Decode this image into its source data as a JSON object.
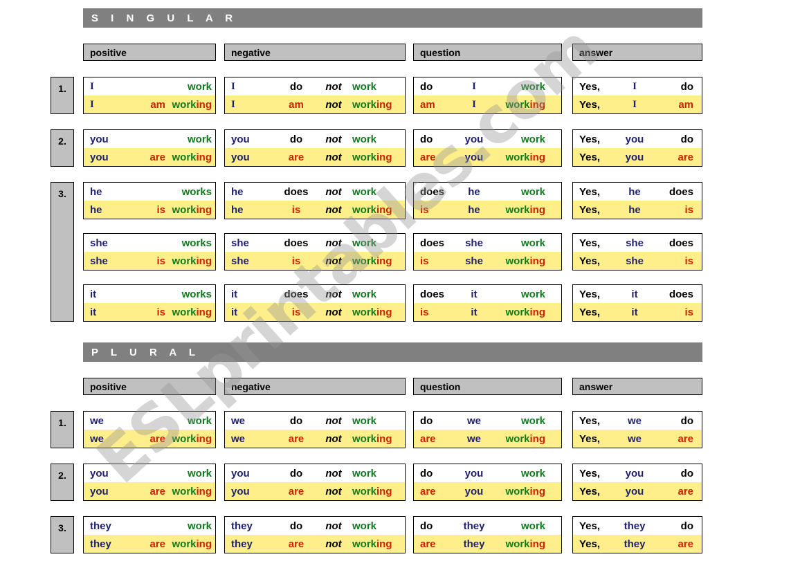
{
  "sections": [
    {
      "title": "S I N G U L A R",
      "headers": [
        "positive",
        "negative",
        "question",
        "answer"
      ],
      "groups": [
        {
          "number": "1.",
          "rows": [
            {
              "positive": {
                "simple": [
                  "I",
                  "",
                  "work"
                ],
                "cont": [
                  "I",
                  "am",
                  "work",
                  "ing"
                ]
              },
              "negative": {
                "simple": [
                  "I",
                  "do",
                  "not",
                  "work"
                ],
                "cont": [
                  "I",
                  "am",
                  "not",
                  "work",
                  "ing"
                ]
              },
              "question": {
                "simple": [
                  "do",
                  "I",
                  "work"
                ],
                "cont": [
                  "am",
                  "I",
                  "work",
                  "ing"
                ]
              },
              "answer": {
                "simple": [
                  "Yes,",
                  "I",
                  "do"
                ],
                "cont": [
                  "Yes,",
                  "I",
                  "am"
                ]
              }
            }
          ]
        },
        {
          "number": "2.",
          "rows": [
            {
              "positive": {
                "simple": [
                  "you",
                  "",
                  "work"
                ],
                "cont": [
                  "you",
                  "are",
                  "work",
                  "ing"
                ]
              },
              "negative": {
                "simple": [
                  "you",
                  "do",
                  "not",
                  "work"
                ],
                "cont": [
                  "you",
                  "are",
                  "not",
                  "work",
                  "ing"
                ]
              },
              "question": {
                "simple": [
                  "do",
                  "you",
                  "work"
                ],
                "cont": [
                  "are",
                  "you",
                  "work",
                  "ing"
                ]
              },
              "answer": {
                "simple": [
                  "Yes,",
                  "you",
                  "do"
                ],
                "cont": [
                  "Yes,",
                  "you",
                  "are"
                ]
              }
            }
          ]
        },
        {
          "number": "3.",
          "rows": [
            {
              "positive": {
                "simple": [
                  "he",
                  "",
                  "works"
                ],
                "cont": [
                  "he",
                  "is",
                  "work",
                  "ing"
                ]
              },
              "negative": {
                "simple": [
                  "he",
                  "does",
                  "not",
                  "work"
                ],
                "cont": [
                  "he",
                  "is",
                  "not",
                  "work",
                  "ing"
                ]
              },
              "question": {
                "simple": [
                  "does",
                  "he",
                  "work"
                ],
                "cont": [
                  "is",
                  "he",
                  "work",
                  "ing"
                ]
              },
              "answer": {
                "simple": [
                  "Yes,",
                  "he",
                  "does"
                ],
                "cont": [
                  "Yes,",
                  "he",
                  "is"
                ]
              }
            },
            {
              "positive": {
                "simple": [
                  "she",
                  "",
                  "works"
                ],
                "cont": [
                  "she",
                  "is",
                  "work",
                  "ing"
                ]
              },
              "negative": {
                "simple": [
                  "she",
                  "does",
                  "not",
                  "work"
                ],
                "cont": [
                  "she",
                  "is",
                  "not",
                  "work",
                  "ing"
                ]
              },
              "question": {
                "simple": [
                  "does",
                  "she",
                  "work"
                ],
                "cont": [
                  "is",
                  "she",
                  "work",
                  "ing"
                ]
              },
              "answer": {
                "simple": [
                  "Yes,",
                  "she",
                  "does"
                ],
                "cont": [
                  "Yes,",
                  "she",
                  "is"
                ]
              }
            },
            {
              "positive": {
                "simple": [
                  "it",
                  "",
                  "works"
                ],
                "cont": [
                  "it",
                  "is",
                  "work",
                  "ing"
                ]
              },
              "negative": {
                "simple": [
                  "it",
                  "does",
                  "not",
                  "work"
                ],
                "cont": [
                  "it",
                  "is",
                  "not",
                  "work",
                  "ing"
                ]
              },
              "question": {
                "simple": [
                  "does",
                  "it",
                  "work"
                ],
                "cont": [
                  "is",
                  "it",
                  "work",
                  "ing"
                ]
              },
              "answer": {
                "simple": [
                  "Yes,",
                  "it",
                  "does"
                ],
                "cont": [
                  "Yes,",
                  "it",
                  "is"
                ]
              }
            }
          ]
        }
      ]
    },
    {
      "title": "P L U R A L",
      "headers": [
        "positive",
        "negative",
        "question",
        "answer"
      ],
      "groups": [
        {
          "number": "1.",
          "rows": [
            {
              "positive": {
                "simple": [
                  "we",
                  "",
                  "work"
                ],
                "cont": [
                  "we",
                  "are",
                  "work",
                  "ing"
                ]
              },
              "negative": {
                "simple": [
                  "we",
                  "do",
                  "not",
                  "work"
                ],
                "cont": [
                  "we",
                  "are",
                  "not",
                  "work",
                  "ing"
                ]
              },
              "question": {
                "simple": [
                  "do",
                  "we",
                  "work"
                ],
                "cont": [
                  "are",
                  "we",
                  "work",
                  "ing"
                ]
              },
              "answer": {
                "simple": [
                  "Yes,",
                  "we",
                  "do"
                ],
                "cont": [
                  "Yes,",
                  "we",
                  "are"
                ]
              }
            }
          ]
        },
        {
          "number": "2.",
          "rows": [
            {
              "positive": {
                "simple": [
                  "you",
                  "",
                  "work"
                ],
                "cont": [
                  "you",
                  "are",
                  "work",
                  "ing"
                ]
              },
              "negative": {
                "simple": [
                  "you",
                  "do",
                  "not",
                  "work"
                ],
                "cont": [
                  "you",
                  "are",
                  "not",
                  "work",
                  "ing"
                ]
              },
              "question": {
                "simple": [
                  "do",
                  "you",
                  "work"
                ],
                "cont": [
                  "are",
                  "you",
                  "work",
                  "ing"
                ]
              },
              "answer": {
                "simple": [
                  "Yes,",
                  "you",
                  "do"
                ],
                "cont": [
                  "Yes,",
                  "you",
                  "are"
                ]
              }
            }
          ]
        },
        {
          "number": "3.",
          "rows": [
            {
              "positive": {
                "simple": [
                  "they",
                  "",
                  "work"
                ],
                "cont": [
                  "they",
                  "are",
                  "work",
                  "ing"
                ]
              },
              "negative": {
                "simple": [
                  "they",
                  "do",
                  "not",
                  "work"
                ],
                "cont": [
                  "they",
                  "are",
                  "not",
                  "work",
                  "ing"
                ]
              },
              "question": {
                "simple": [
                  "do",
                  "they",
                  "work"
                ],
                "cont": [
                  "are",
                  "they",
                  "work",
                  "ing"
                ]
              },
              "answer": {
                "simple": [
                  "Yes,",
                  "they",
                  "do"
                ],
                "cont": [
                  "Yes,",
                  "they",
                  "are"
                ]
              }
            }
          ]
        }
      ]
    }
  ],
  "watermark": "ESLprintables.com",
  "colors": {
    "subject": "#1f2070",
    "verb": "#127a20",
    "auxiliary": "#cc2200",
    "negation": "#000000",
    "highlight": "#ffef8a",
    "header_bar": "#808080",
    "column_header": "#c0c0c0"
  }
}
